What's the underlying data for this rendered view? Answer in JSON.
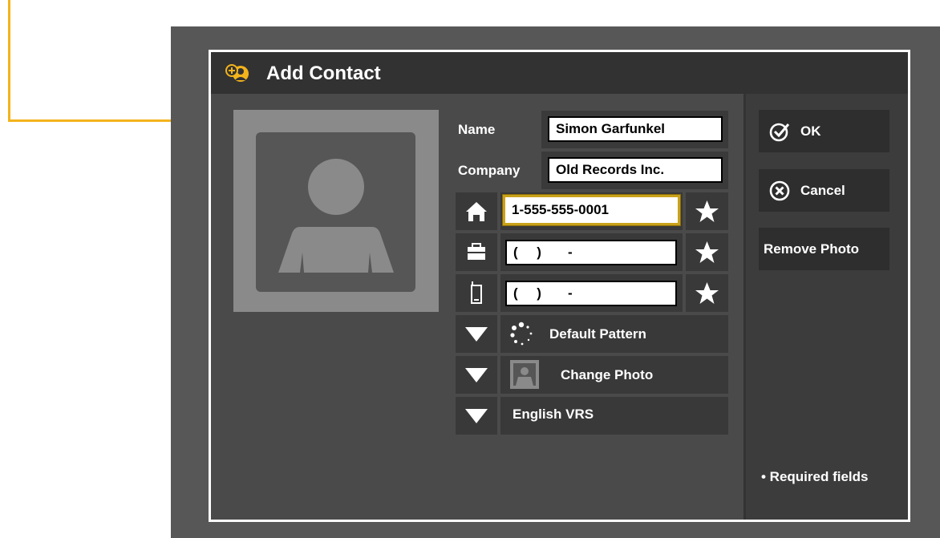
{
  "dialog": {
    "title": "Add Contact"
  },
  "form": {
    "name_label": "Name",
    "name_value": "Simon Garfunkel",
    "company_label": "Company",
    "company_value": "Old Records Inc.",
    "phones": [
      {
        "type": "home",
        "icon": "house-icon",
        "value": "1-555-555-0001",
        "focused": true
      },
      {
        "type": "work",
        "icon": "briefcase-icon",
        "value": "(     )       -"
      },
      {
        "type": "mobile",
        "icon": "mobile-phone-icon",
        "value": "(     )       -"
      }
    ],
    "ring_pattern": "Default Pattern",
    "photo_option": "Change Photo",
    "language": "English VRS"
  },
  "buttons": {
    "ok": "OK",
    "cancel": "Cancel",
    "remove_photo": "Remove Photo"
  },
  "footer": {
    "required_note": "• Required fields"
  },
  "colors": {
    "callout": "#F2B31C",
    "focus_border": "#C9A21A"
  }
}
